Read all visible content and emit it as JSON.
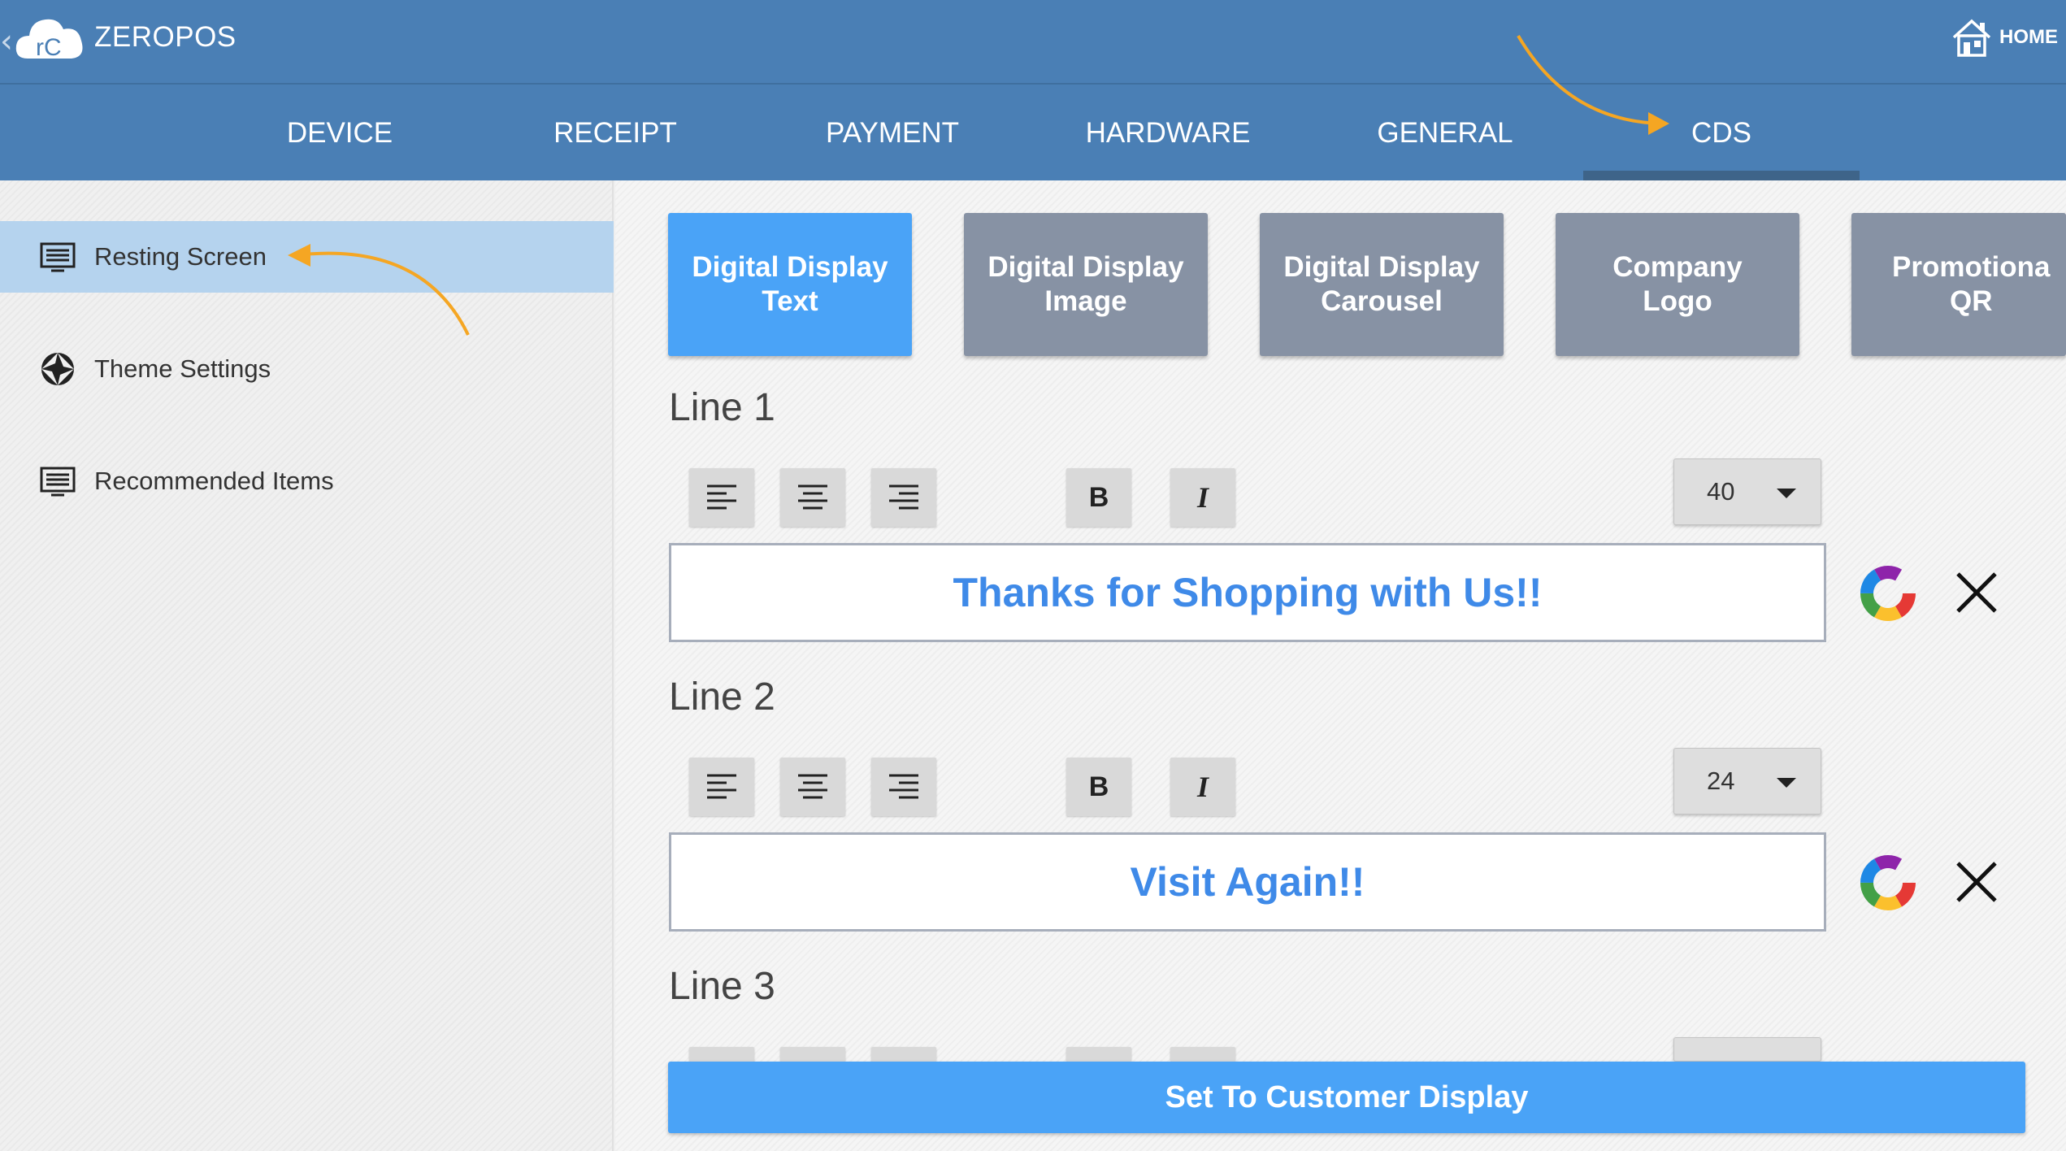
{
  "header": {
    "title": "ZEROPOS",
    "logo_text": "rC",
    "home_label": "HOME"
  },
  "tabs": [
    {
      "label": "DEVICE",
      "active": false
    },
    {
      "label": "RECEIPT",
      "active": false
    },
    {
      "label": "PAYMENT",
      "active": false
    },
    {
      "label": "HARDWARE",
      "active": false
    },
    {
      "label": "GENERAL",
      "active": false
    },
    {
      "label": "CDS",
      "active": true
    }
  ],
  "sidebar": {
    "items": [
      {
        "label": "Resting Screen",
        "icon": "list-icon",
        "active": true
      },
      {
        "label": "Theme Settings",
        "icon": "aperture-icon",
        "active": false
      },
      {
        "label": "Recommended Items",
        "icon": "list-icon",
        "active": false
      }
    ]
  },
  "subtabs": [
    {
      "label": "Digital Display\nText",
      "active": true
    },
    {
      "label": "Digital Display\nImage",
      "active": false
    },
    {
      "label": "Digital Display\nCarousel",
      "active": false
    },
    {
      "label": "Company\nLogo",
      "active": false
    },
    {
      "label": "Promotiona\nQR",
      "active": false
    }
  ],
  "lines": [
    {
      "title": "Line 1",
      "font_size": "40",
      "text": "Thanks for Shopping with Us!!"
    },
    {
      "title": "Line 2",
      "font_size": "24",
      "text": "Visit Again!!"
    },
    {
      "title": "Line 3"
    }
  ],
  "set_button_label": "Set To Customer Display",
  "colors": {
    "primary": "#4a7fb5",
    "accent": "#4aa3f7",
    "text_blue": "#3f8ae8",
    "annotation": "#f5a623"
  }
}
